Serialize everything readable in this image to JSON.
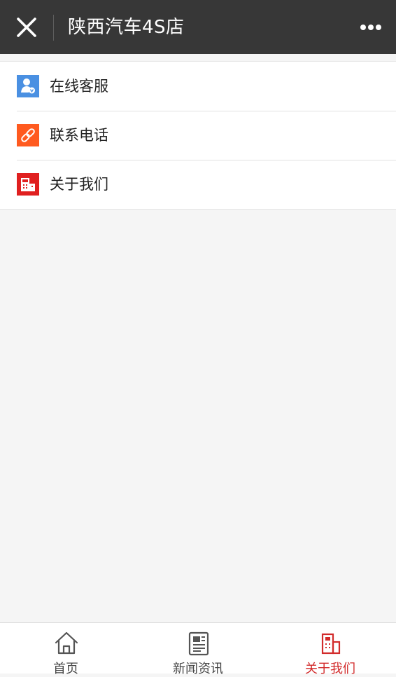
{
  "header": {
    "title": "陕西汽车4S店"
  },
  "menu": {
    "items": [
      {
        "label": "在线客服",
        "icon": "customer-service-icon",
        "color": "#4a90e2"
      },
      {
        "label": "联系电话",
        "icon": "link-icon",
        "color": "#ff5a1f"
      },
      {
        "label": "关于我们",
        "icon": "building-icon",
        "color": "#e02020"
      }
    ]
  },
  "tabbar": {
    "tabs": [
      {
        "label": "首页",
        "icon": "home-icon",
        "active": false
      },
      {
        "label": "新闻资讯",
        "icon": "news-icon",
        "active": false
      },
      {
        "label": "关于我们",
        "icon": "building-icon",
        "active": true
      }
    ],
    "active_color": "#d22b2b"
  },
  "colors": {
    "topbar_bg": "#373737",
    "page_bg": "#f5f5f5"
  }
}
